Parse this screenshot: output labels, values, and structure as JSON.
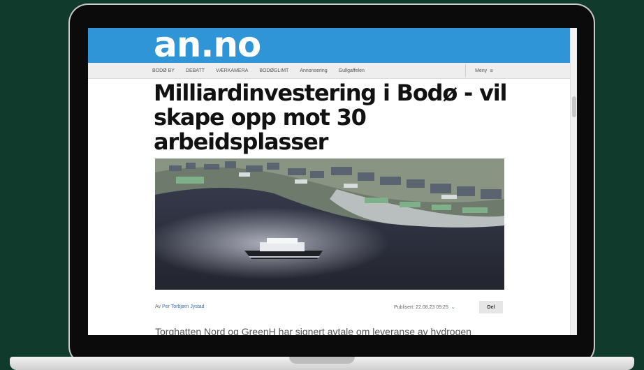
{
  "site": {
    "logo": "an.no"
  },
  "nav": {
    "items": [
      "BODØ BY",
      "DEBATT",
      "VÆRKAMERA",
      "BODØGLIMT",
      "Annonsering",
      "Gullgaffelen"
    ],
    "menu_label": "Meny"
  },
  "article": {
    "title": "Milliardinvestering i Bodø - vil skape opp mot 30 arbeidsplasser",
    "byline_prefix": "Av",
    "author": "Per Torbjørn Jystad",
    "published": "Publisert: 22.08.23 09:25",
    "share_label": "Del",
    "lead": "Torghatten Nord og GreenH har signert avtale om leveranse av hydrogen"
  },
  "colors": {
    "brand": "#2f95d7",
    "background": "#0f3a2c"
  },
  "icons": {
    "menu": "hamburger-icon",
    "expand": "chevron-down-icon"
  }
}
